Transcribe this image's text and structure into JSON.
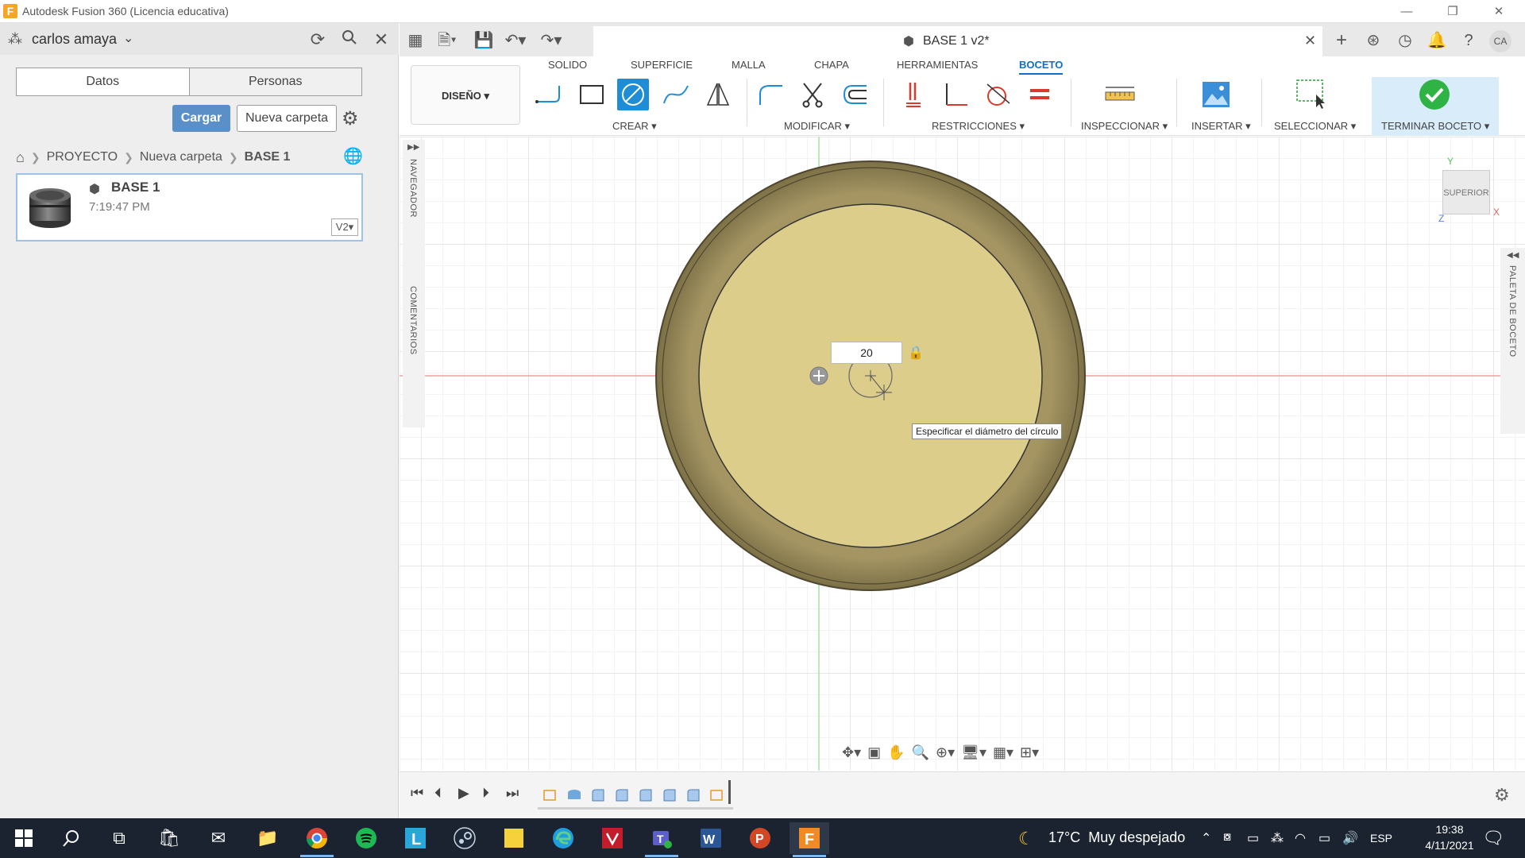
{
  "window": {
    "title": "Autodesk Fusion 360 (Licencia educativa)",
    "app_icon_letter": "F",
    "minimize": "—",
    "restore": "❐",
    "close": "✕"
  },
  "data_panel": {
    "user": "carlos amaya",
    "tabs": [
      "Datos",
      "Personas"
    ],
    "upload_label": "Cargar",
    "new_folder_label": "Nueva carpeta",
    "breadcrumb": [
      "PROYECTO",
      "Nueva carpeta",
      "BASE 1"
    ],
    "file": {
      "name": "BASE 1",
      "time": "7:19:47 PM",
      "version": "V2▾"
    }
  },
  "document": {
    "title": "BASE 1 v2*",
    "close": "✕"
  },
  "toolbar": {
    "workspace": "DISEÑO ▾",
    "tabs": [
      "SOLIDO",
      "SUPERFICIE",
      "MALLA",
      "CHAPA",
      "HERRAMIENTAS",
      "BOCETO"
    ],
    "active_tab": "BOCETO",
    "groups": {
      "create": "CREAR ▾",
      "modify": "MODIFICAR ▾",
      "constraints": "RESTRICCIONES ▾",
      "inspect": "INSPECCIONAR ▾",
      "insert": "INSERTAR ▾",
      "select": "SELECCIONAR ▾",
      "finish": "TERMINAR BOCETO ▾"
    },
    "accent": "#1f8dd6"
  },
  "canvas": {
    "navigator_label": "NAVEGADOR",
    "comments_label": "COMENTARIOS",
    "sketch_palette_label": "PALETA DE BOCETO",
    "viewcube_label": "SUPERIOR",
    "axis_y": "Y",
    "axis_x": "X",
    "axis_z": "Z",
    "dimension_value": "20",
    "tooltip": "Especificar el diámetro del círculo",
    "sketch_fill": "#dccd8a",
    "ring_color": "#8f8354"
  },
  "taskbar": {
    "weather_temp": "17°C",
    "weather_text": "Muy despejado",
    "language": "ESP",
    "time": "19:38",
    "date": "4/11/2021"
  }
}
